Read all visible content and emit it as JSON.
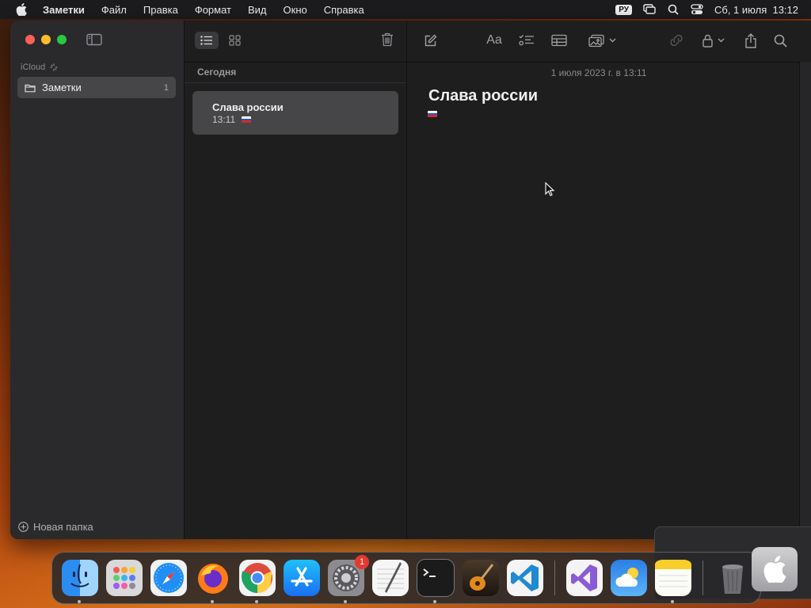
{
  "menubar": {
    "apple_icon": "apple-logo-icon",
    "app_name": "Заметки",
    "items": [
      "Файл",
      "Правка",
      "Формат",
      "Вид",
      "Окно",
      "Справка"
    ],
    "keyboard_layout": "РУ",
    "datetime": "Сб, 1 июля  13:12"
  },
  "sidebar": {
    "account": "iCloud",
    "folders": [
      {
        "label": "Заметки",
        "count": "1"
      }
    ],
    "new_folder_label": "Новая папка"
  },
  "note_list": {
    "section": "Сегодня",
    "notes": [
      {
        "title": "Слава россии",
        "time": "13:11"
      }
    ]
  },
  "editor": {
    "date": "1 июля 2023 г. в 13:11",
    "title": "Слава россии",
    "format_label": "Aa"
  },
  "dock": {
    "apps": [
      "Finder",
      "Launchpad",
      "Safari",
      "Firefox",
      "Chrome",
      "App Store",
      "System Settings",
      "TextEdit",
      "Terminal",
      "GarageBand",
      "VS Code",
      "Visual Studio",
      "Weather",
      "Notes",
      "Trash"
    ],
    "settings_badge": "1"
  },
  "colors": {
    "accent_red": "#ff5f57",
    "accent_yellow": "#febc2e",
    "accent_green": "#28c840",
    "selection": "#464649",
    "badge": "#e6382f"
  }
}
